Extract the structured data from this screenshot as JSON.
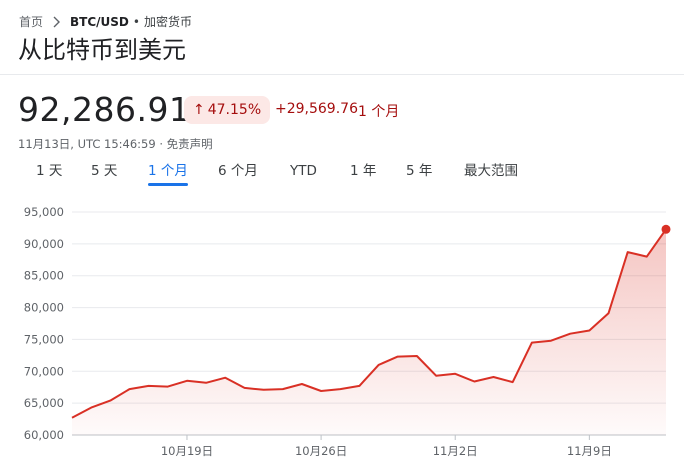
{
  "breadcrumb": {
    "home": "首页",
    "pair": "BTC/USD",
    "separator": "•",
    "category": "加密货币"
  },
  "title": "从比特币到美元",
  "quote": {
    "price": "92,286.91",
    "change_pct": "47.15%",
    "change_direction": "up",
    "change_abs": "+29,569.76",
    "period": "1 个月",
    "timestamp": "11月13日, UTC 15:46:59 · 免责声明"
  },
  "ranges": [
    {
      "label": "1 天",
      "active": false
    },
    {
      "label": "5 天",
      "active": false
    },
    {
      "label": "1 个月",
      "active": true
    },
    {
      "label": "6 个月",
      "active": false
    },
    {
      "label": "YTD",
      "active": false
    },
    {
      "label": "1 年",
      "active": false
    },
    {
      "label": "5 年",
      "active": false
    },
    {
      "label": "最大范围",
      "active": false
    }
  ],
  "colors": {
    "line": "#d93025",
    "fill": "#d93025",
    "grid": "#e8eaed",
    "accent": "#1a73e8",
    "negative_bg": "#fce8e6",
    "negative_text": "#a50e0e"
  },
  "chart_data": {
    "type": "area",
    "ylim": [
      60000,
      95000
    ],
    "y_ticks": [
      "95,000",
      "90,000",
      "85,000",
      "80,000",
      "75,000",
      "70,000",
      "65,000",
      "60,000"
    ],
    "y_tick_values": [
      95000,
      90000,
      85000,
      80000,
      75000,
      70000,
      65000,
      60000
    ],
    "x_ticks": [
      {
        "label": "10月19日",
        "index": 6
      },
      {
        "label": "10月26日",
        "index": 13
      },
      {
        "label": "11月2日",
        "index": 20
      },
      {
        "label": "11月9日",
        "index": 27
      }
    ],
    "grid": true,
    "series": [
      {
        "values": [
          62700,
          64300,
          65400,
          67200,
          67700,
          67600,
          68500,
          68200,
          69000,
          67400,
          67100,
          67200,
          68000,
          66900,
          67200,
          67700,
          71000,
          72300,
          72400,
          69300,
          69600,
          68400,
          69100,
          68300,
          74500,
          74800,
          75900,
          76400,
          79100,
          88700,
          88000,
          92287
        ]
      }
    ]
  }
}
